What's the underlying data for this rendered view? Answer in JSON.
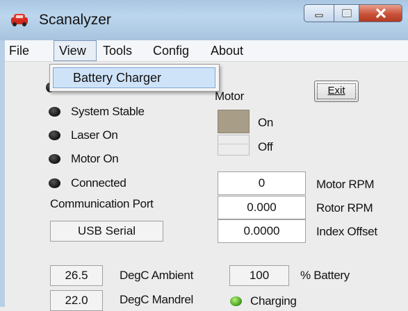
{
  "window": {
    "title": "Scanalyzer",
    "icon": "red-car-icon"
  },
  "menu": {
    "items": [
      "File",
      "View",
      "Tools",
      "Config",
      "About"
    ],
    "open_menu": "View",
    "dropdown_items": [
      "Battery Charger"
    ]
  },
  "status": {
    "items": [
      {
        "label": "System Stable",
        "led": "off"
      },
      {
        "label": "Laser On",
        "led": "off"
      },
      {
        "label": "Motor On",
        "led": "off"
      },
      {
        "label": "Connected",
        "led": "off"
      }
    ]
  },
  "communication": {
    "label": "Communication Port",
    "port": "USB Serial"
  },
  "motor": {
    "label": "Motor",
    "on_label": "On",
    "off_label": "Off",
    "state": "On"
  },
  "exit_button": "Exit",
  "readouts": [
    {
      "value": "0",
      "label": "Motor RPM"
    },
    {
      "value": "0.000",
      "label": "Rotor RPM"
    },
    {
      "value": "0.0000",
      "label": "Index Offset"
    }
  ],
  "temperatures": [
    {
      "value": "26.5",
      "label": "DegC Ambient"
    },
    {
      "value": "22.0",
      "label": "DegC Mandrel"
    }
  ],
  "battery": {
    "value": "100",
    "label": "% Battery",
    "charging_label": "Charging"
  },
  "colors": {
    "titlebar": "#bcd6ee",
    "menu_highlight": "#cfe3f8",
    "motor_on_fill": "#a89e88",
    "led_off": "#111111",
    "led_charging": "#3c9a18"
  }
}
